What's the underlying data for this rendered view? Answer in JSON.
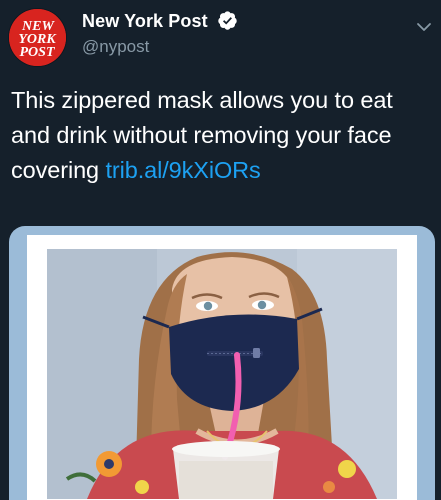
{
  "account": {
    "display_name": "New York Post",
    "handle": "@nypost",
    "logo_lines": [
      "NEW",
      "YORK",
      "POST"
    ]
  },
  "tweet": {
    "text_before_link": "This zippered mask allows you to eat and drink without removing your face covering ",
    "link_text": "trib.al/9kXiORs"
  },
  "icons": {
    "verified": "verified-badge-icon",
    "caret": "chevron-down-icon"
  },
  "colors": {
    "background": "#15202b",
    "link": "#1da1f2",
    "secondary_text": "#8899a6",
    "brand_red": "#d8241f"
  }
}
